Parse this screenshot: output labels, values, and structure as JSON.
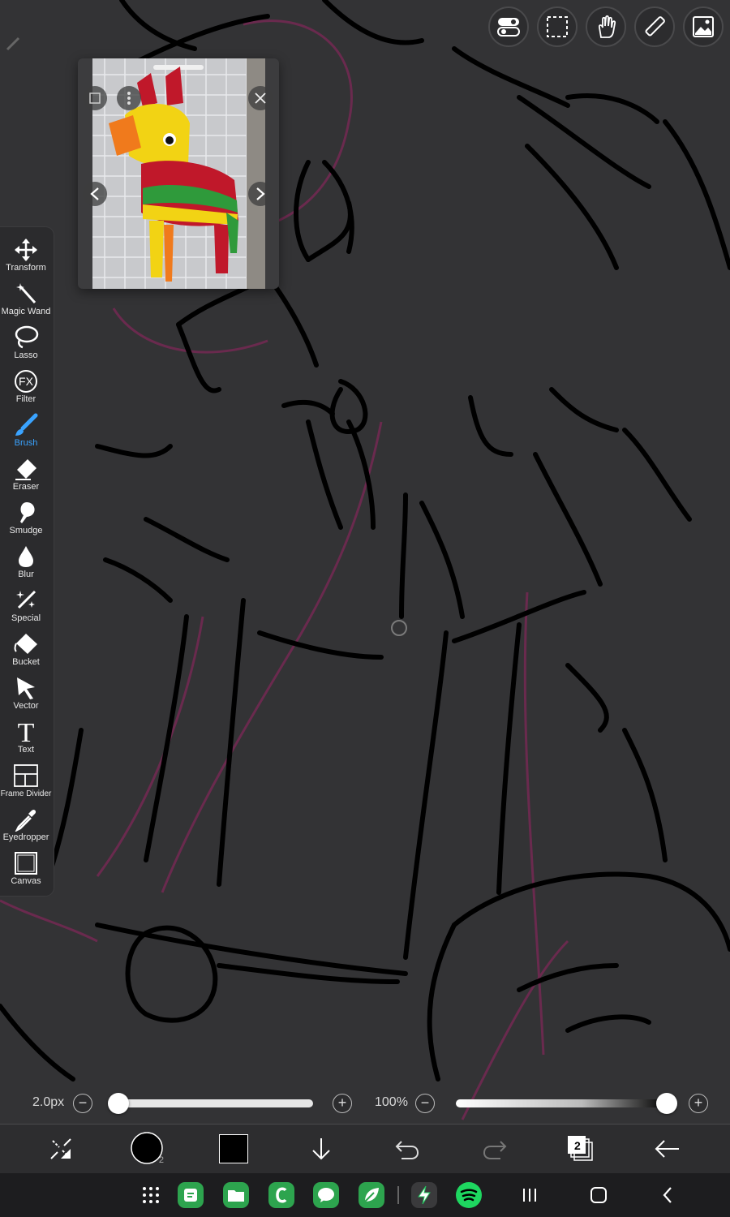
{
  "toolbar": {
    "tools": [
      {
        "label": "Transform",
        "icon": "move-arrows-icon"
      },
      {
        "label": "Magic Wand",
        "icon": "magic-wand-icon"
      },
      {
        "label": "Lasso",
        "icon": "lasso-icon"
      },
      {
        "label": "Filter",
        "icon": "fx-filter-icon"
      },
      {
        "label": "Brush",
        "icon": "brush-icon",
        "active": true
      },
      {
        "label": "Eraser",
        "icon": "eraser-icon"
      },
      {
        "label": "Smudge",
        "icon": "smudge-icon"
      },
      {
        "label": "Blur",
        "icon": "droplet-icon"
      },
      {
        "label": "Special",
        "icon": "sparkle-pen-icon"
      },
      {
        "label": "Bucket",
        "icon": "bucket-icon"
      },
      {
        "label": "Vector",
        "icon": "arrow-pointer-icon"
      },
      {
        "label": "Text",
        "icon": "text-t-icon"
      },
      {
        "label": "Frame Divider",
        "icon": "frame-divider-icon"
      },
      {
        "label": "Eyedropper",
        "icon": "eyedropper-icon"
      },
      {
        "label": "Canvas",
        "icon": "canvas-icon"
      }
    ],
    "active_color": "#3aa3ff"
  },
  "top_tools": [
    "toggle-switch-icon",
    "selection-icon",
    "hand-icon",
    "ruler-icon",
    "image-icon"
  ],
  "reference_window": {
    "subject": "pinata-photo"
  },
  "sliders": {
    "brush_size_label": "2.0px",
    "brush_size_fraction": 0.0,
    "opacity_label": "100%",
    "opacity_fraction": 1.0
  },
  "bottom_bar": {
    "items": [
      "quick-menu-icon",
      "brush-preview",
      "color-swatch",
      "download-icon",
      "undo-icon",
      "redo-icon",
      "layers-icon",
      "back-arrow-icon"
    ],
    "brush_size_badge": "2",
    "layer_count": "2",
    "current_color": "#000000"
  },
  "nav": {
    "apps": [
      "app-drawer-icon",
      "notes-app-icon",
      "files-app-icon",
      "clip-app-icon",
      "chat-app-icon",
      "leaf-app-icon",
      "flash-app-icon",
      "spotify-app-icon"
    ],
    "buttons": [
      "recents-icon",
      "home-icon",
      "back-icon"
    ]
  }
}
